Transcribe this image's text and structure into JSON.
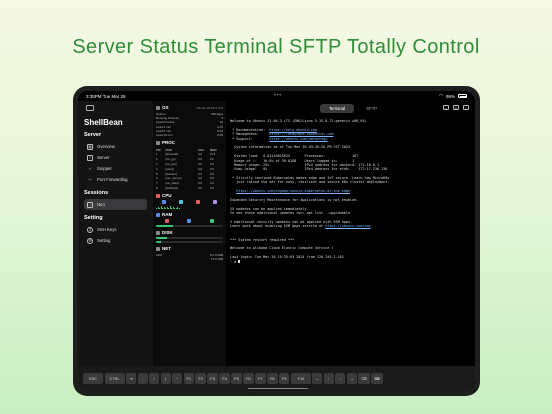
{
  "headline": "Server Status Terminal SFTP Totally Control",
  "status_bar": {
    "time": "3:35PM",
    "date": "Tue Mar 26",
    "battery": "95%"
  },
  "sidebar": {
    "app_title": "ShellBean",
    "sections": [
      {
        "title": "Server",
        "items": [
          {
            "label": "Overview",
            "icon": "grid-icon"
          },
          {
            "label": "Server",
            "icon": "server-icon"
          },
          {
            "label": "Snippet",
            "icon": "code-icon"
          },
          {
            "label": "Port Forwarding",
            "icon": "forward-icon"
          }
        ]
      },
      {
        "title": "Sessions",
        "items": [
          {
            "label": "Neo",
            "icon": "terminal-icon",
            "selected": true
          }
        ]
      },
      {
        "title": "Setting",
        "items": [
          {
            "label": "SSH Keys",
            "icon": "key-icon"
          },
          {
            "label": "Setting",
            "icon": "gear-icon"
          }
        ]
      }
    ]
  },
  "tabs": [
    {
      "label": "Terminal",
      "active": true
    },
    {
      "label": "SFTP",
      "active": false
    }
  ],
  "monitor": {
    "os": {
      "title": "OS",
      "subtitle": "Ubuntu 22.04.3 LTS"
    },
    "os_rows": [
      [
        "Uptime",
        "435 days"
      ],
      [
        "Running Process",
        "6"
      ],
      [
        "Load Process",
        "10"
      ],
      [
        "Load 1 min",
        "0.10"
      ],
      [
        "Load 5 min",
        "0.04"
      ],
      [
        "Load 15 min",
        "0.05"
      ]
    ],
    "proc": {
      "title": "PROC",
      "headers": [
        "PID",
        "CMD",
        "CPU",
        "MEM"
      ],
      "rows": [
        [
          "1",
          "[kthreadd]",
          "0.0",
          "11.5"
        ],
        [
          "2",
          "[rcu_gp]",
          "0.0",
          "0.0"
        ],
        [
          "3",
          "[rcu_par]",
          "0.0",
          "0.0"
        ],
        [
          "4",
          "[netns]",
          "0.0",
          "0.0"
        ],
        [
          "5",
          "[kworker]",
          "0.0",
          "0.0"
        ],
        [
          "6",
          "[mm_percpu]",
          "0.0",
          "0.0"
        ],
        [
          "7",
          "[rcu_tasks]",
          "0.0",
          "0.0"
        ],
        [
          "8",
          "[ksoftirqd]",
          "0.0",
          "0.0"
        ]
      ]
    },
    "cpu": {
      "title": "CPU"
    },
    "ram": {
      "title": "RAM"
    },
    "disk": {
      "title": "DISK"
    },
    "net": {
      "title": "NET",
      "rows": [
        [
          "eth0",
          "RX 0.00B"
        ],
        [
          "",
          "TX 0.00B"
        ]
      ]
    }
  },
  "terminal": {
    "lines": [
      "Welcome to Ubuntu 22.04.3 LTS (GNU/Linux 5.15.0-71-generic x86_64)",
      "",
      " * Documentation:  https://help.ubuntu.com",
      " * Management:     https://landscape.canonical.com",
      " * Support:        https://ubuntu.com/advantage",
      "",
      "  System information as of Tue Mar 26 03:35:20 PM CST 2024",
      "",
      "  System load:  0.01416015625       Processes:             167",
      "  Usage of /:   16.6% of 39.01GB    Users logged in:       1",
      "  Memory usage: 25%                 IPv4 address for docker0: 172.18.0.1",
      "  Swap usage:   0%                  IPv4 address for eth0:    172.17.236.136",
      "",
      " * Strictly confined Kubernetes makes edge and IoT secure. Learn how MicroK8s",
      "   just raised the bar for easy, resilient and secure K8s cluster deployment.",
      "",
      "   https://ubuntu.com/engage/secure-kubernetes-at-the-edge",
      "",
      "Expanded Security Maintenance for Applications is not enabled.",
      "",
      "25 updates can be applied immediately.",
      "To see these additional updates run: apt list --upgradable",
      "",
      "2 additional security updates can be applied with ESM Apps.",
      "Learn more about enabling ESM Apps service at https://ubuntu.com/esm",
      "",
      "",
      "*** System restart required ***",
      "",
      "Welcome to Alibaba Cloud Elastic Compute Service !",
      "",
      "Last login: Tue Mar 26 15:35:03 2024 from 120.244.2.162",
      "~ #"
    ]
  },
  "keybar": [
    "ESC",
    "CTRL",
    "⇥",
    "-",
    "/",
    "|",
    "~",
    "F1",
    "F2",
    "F3",
    "F4",
    "F5",
    "F6",
    "F7",
    "F8",
    "F9",
    "F10",
    "←",
    "↑",
    "↓",
    "→",
    "⌫",
    "⌨"
  ]
}
